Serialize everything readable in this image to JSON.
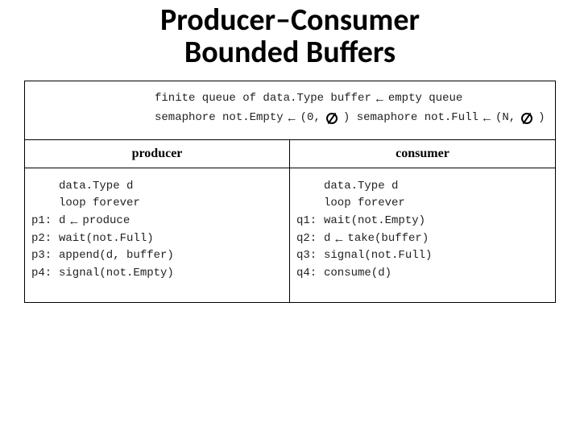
{
  "title_line1": "Producer–Consumer",
  "title_line2": "Bounded Buffers",
  "shared": {
    "buffer_decl_pre": "finite queue of data.Type buffer",
    "buffer_decl_post": "empty queue",
    "sem_empty_pre": "semaphore not.Empty",
    "sem_empty_post_open": "(0,",
    "sem_empty_post_close": ")",
    "sem_full_pre": "semaphore not.Full",
    "sem_full_post_open": "(N,",
    "sem_full_post_close": ")"
  },
  "producer": {
    "header": "producer",
    "decl": "data.Type d",
    "loop": "loop forever",
    "l1_label": "p1:",
    "l1_pre": "d",
    "l1_post": "produce",
    "l2_label": "p2:",
    "l2": "wait(not.Full)",
    "l3_label": "p3:",
    "l3": "append(d, buffer)",
    "l4_label": "p4:",
    "l4": "signal(not.Empty)"
  },
  "consumer": {
    "header": "consumer",
    "decl": "data.Type d",
    "loop": "loop forever",
    "l1_label": "q1:",
    "l1": "wait(not.Empty)",
    "l2_label": "q2:",
    "l2_pre": "d",
    "l2_post": "take(buffer)",
    "l3_label": "q3:",
    "l3": "signal(not.Full)",
    "l4_label": "q4:",
    "l4": "consume(d)"
  }
}
